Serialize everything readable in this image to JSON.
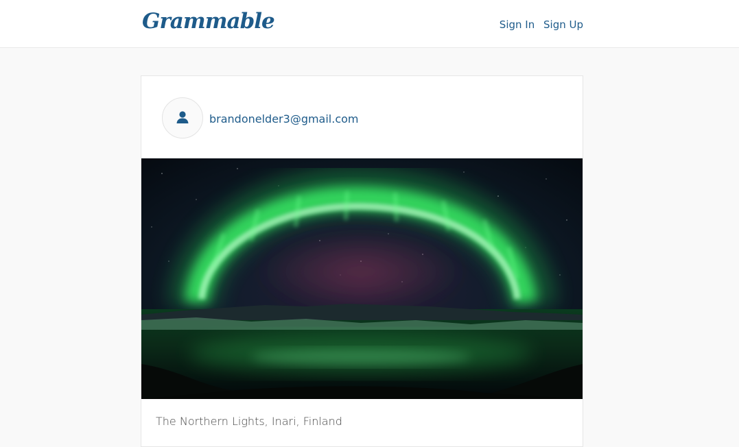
{
  "navbar": {
    "brand": "Grammable",
    "sign_in_label": "Sign In",
    "sign_up_label": "Sign Up"
  },
  "post": {
    "author_email": "brandonelder3@gmail.com",
    "avatar_icon": "user-icon",
    "photo_subject": "aurora borealis over a lake at night",
    "caption": "The Northern Lights, Inari, Finland"
  },
  "colors": {
    "brand": "#1e5b8a",
    "page_background": "#f9f9f9",
    "card_background": "#ffffff",
    "aurora_green": "#3dff6a"
  }
}
